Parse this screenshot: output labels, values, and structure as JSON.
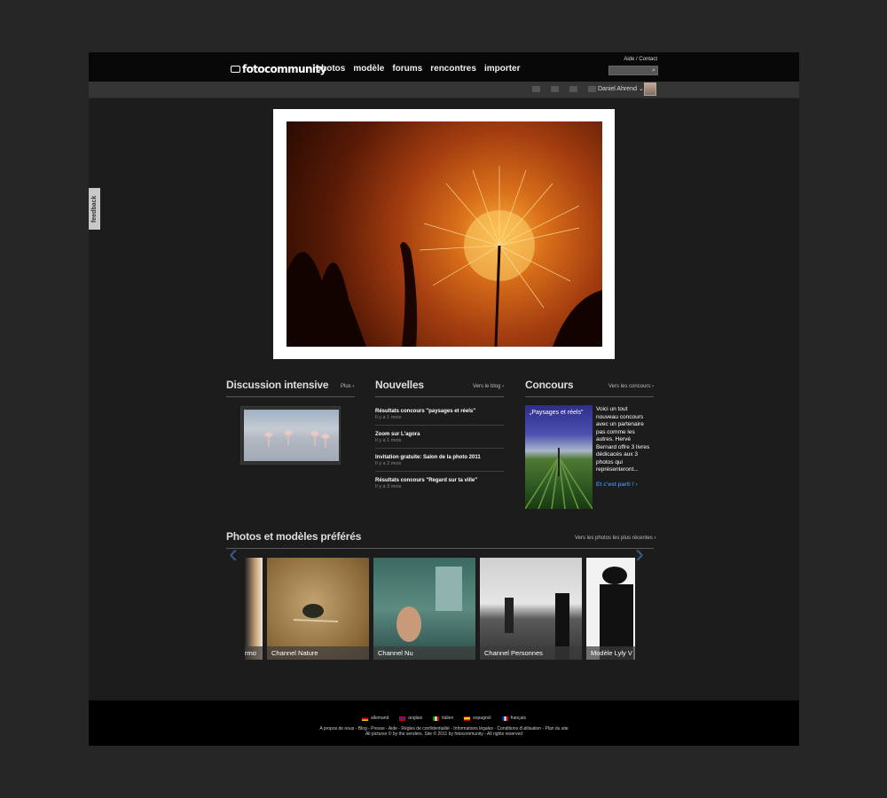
{
  "header": {
    "logo_text": "fotocommunity",
    "nav": [
      "photos",
      "modèle",
      "forums",
      "rencontres",
      "importer"
    ],
    "help_link": "Aide / Contact",
    "search_placeholder": "",
    "user_name": "Daniel Ahrend"
  },
  "feedback_label": "feedback",
  "hero": {
    "credit": "..."
  },
  "discussion": {
    "title": "Discussion intensive",
    "link": "Plus"
  },
  "news": {
    "title": "Nouvelles",
    "link": "Vers le blog",
    "items": [
      {
        "title": "Résultats concours \"paysages et réels\"",
        "date": "Il y a 1 mois"
      },
      {
        "title": "Zoom sur L'agora",
        "date": "Il y a 1 mois"
      },
      {
        "title": "Invitation gratuite: Salon de la photo 2011",
        "date": "Il y a 2 mois"
      },
      {
        "title": "Résultats concours \"Regard sur ta ville\"",
        "date": "Il y a 3 mois"
      }
    ]
  },
  "contest": {
    "title": "Concours",
    "link": "Vers les concours",
    "image_caption": "„Paysages et réels\"",
    "text": "Voici un tout nouveau concours avec un partenaire pas comme les autres. Hervé Bernard offre 3 livres dédicacés aux 3 photos qui représenteront...",
    "cta": "Et c'est parti !"
  },
  "favorites": {
    "title": "Photos et modèles préférés",
    "link": "Vers les photos les plus récentes",
    "cards": [
      "rmo",
      "Channel Nature",
      "Channel Nu",
      "Channel Personnes",
      "Modèle Lyly V"
    ]
  },
  "footer": {
    "languages": [
      "allemand",
      "anglais",
      "italien",
      "espagnol",
      "français"
    ],
    "links": "A propos de nous - Blog - Presse - Aide - Règles de confidentialité - Informations légales - Conditions d'utilisation - Plan du site",
    "copyright": "All pictures © by the senders. Site © 2011 by fotocommunity - All rights reserved"
  },
  "colors": {
    "background": "#262626",
    "page": "#1c1c1c",
    "topbar": "#080808",
    "link_blue": "#3d8ad6"
  }
}
